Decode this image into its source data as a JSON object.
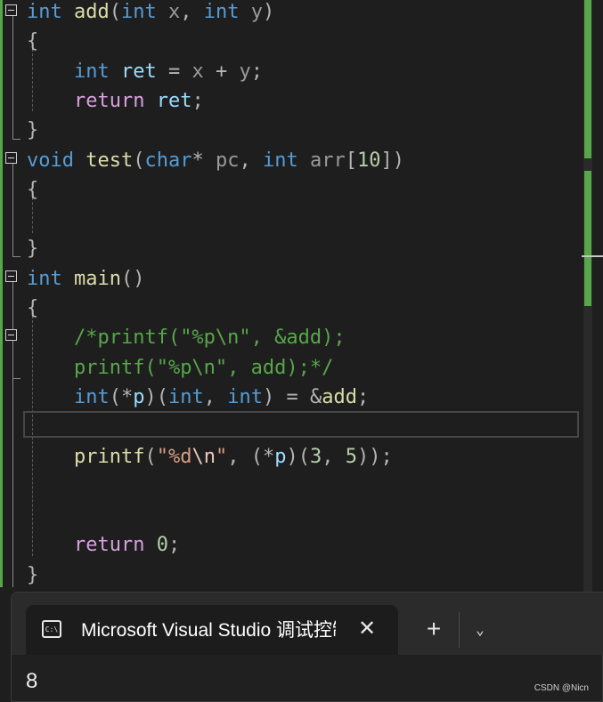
{
  "editor": {
    "lines": [
      [
        [
          "kw",
          "int"
        ],
        [
          "pun",
          " "
        ],
        [
          "fn",
          "add"
        ],
        [
          "pun",
          "("
        ],
        [
          "kw",
          "int"
        ],
        [
          "pun",
          " "
        ],
        [
          "param",
          "x"
        ],
        [
          "pun",
          ", "
        ],
        [
          "kw",
          "int"
        ],
        [
          "pun",
          " "
        ],
        [
          "param",
          "y"
        ],
        [
          "pun",
          ")"
        ]
      ],
      [
        [
          "pun",
          "{"
        ]
      ],
      [
        [
          "pun",
          "    "
        ],
        [
          "kw",
          "int"
        ],
        [
          "pun",
          " "
        ],
        [
          "var",
          "ret"
        ],
        [
          "pun",
          " = "
        ],
        [
          "param",
          "x"
        ],
        [
          "pun",
          " + "
        ],
        [
          "param",
          "y"
        ],
        [
          "pun",
          ";"
        ]
      ],
      [
        [
          "pun",
          "    "
        ],
        [
          "ctl",
          "return"
        ],
        [
          "pun",
          " "
        ],
        [
          "var",
          "ret"
        ],
        [
          "pun",
          ";"
        ]
      ],
      [
        [
          "pun",
          "}"
        ]
      ],
      [
        [
          "kw",
          "void"
        ],
        [
          "pun",
          " "
        ],
        [
          "fn",
          "test"
        ],
        [
          "pun",
          "("
        ],
        [
          "kw",
          "char"
        ],
        [
          "pun",
          "* "
        ],
        [
          "param",
          "pc"
        ],
        [
          "pun",
          ", "
        ],
        [
          "kw",
          "int"
        ],
        [
          "pun",
          " "
        ],
        [
          "param",
          "arr"
        ],
        [
          "pun",
          "["
        ],
        [
          "num",
          "10"
        ],
        [
          "pun",
          "])"
        ]
      ],
      [
        [
          "pun",
          "{"
        ]
      ],
      [],
      [
        [
          "pun",
          "}"
        ]
      ],
      [
        [
          "kw",
          "int"
        ],
        [
          "pun",
          " "
        ],
        [
          "fn",
          "main"
        ],
        [
          "pun",
          "()"
        ]
      ],
      [
        [
          "pun",
          "{"
        ]
      ],
      [
        [
          "pun",
          "    "
        ],
        [
          "cmt",
          "/*printf(\"%p\\n\", &add);"
        ]
      ],
      [
        [
          "pun",
          "    "
        ],
        [
          "cmt",
          "printf(\"%p\\n\", add);*/"
        ]
      ],
      [
        [
          "pun",
          "    "
        ],
        [
          "kw",
          "int"
        ],
        [
          "pun",
          "(*"
        ],
        [
          "var",
          "p"
        ],
        [
          "pun",
          ")("
        ],
        [
          "kw",
          "int"
        ],
        [
          "pun",
          ", "
        ],
        [
          "kw",
          "int"
        ],
        [
          "pun",
          ") = &"
        ],
        [
          "fn",
          "add"
        ],
        [
          "pun",
          ";"
        ]
      ],
      [],
      [
        [
          "pun",
          "    "
        ],
        [
          "fn",
          "printf"
        ],
        [
          "pun",
          "("
        ],
        [
          "str",
          "\"%d"
        ],
        [
          "esc",
          "\\n"
        ],
        [
          "str",
          "\""
        ],
        [
          "pun",
          ", (*"
        ],
        [
          "var",
          "p"
        ],
        [
          "pun",
          ")("
        ],
        [
          "num",
          "3"
        ],
        [
          "pun",
          ", "
        ],
        [
          "num",
          "5"
        ],
        [
          "pun",
          "));"
        ]
      ],
      [],
      [],
      [
        [
          "pun",
          "    "
        ],
        [
          "ctl",
          "return"
        ],
        [
          "pun",
          " "
        ],
        [
          "num",
          "0"
        ],
        [
          "pun",
          ";"
        ]
      ],
      [
        [
          "pun",
          "}"
        ]
      ]
    ]
  },
  "terminal": {
    "tab_icon_text": "C:\\",
    "tab_title": "Microsoft Visual Studio 调试控制台",
    "close_glyph": "✕",
    "new_tab_glyph": "+",
    "dropdown_glyph": "⌄",
    "output": "8"
  },
  "watermark": "CSDN @Nicn",
  "colors": {
    "background": "#1e1e1e",
    "keyword": "#569cd6",
    "control": "#d8a0df",
    "function": "#dcdcaa",
    "comment": "#57a64a",
    "number": "#b5cea8",
    "string": "#d69d85"
  }
}
